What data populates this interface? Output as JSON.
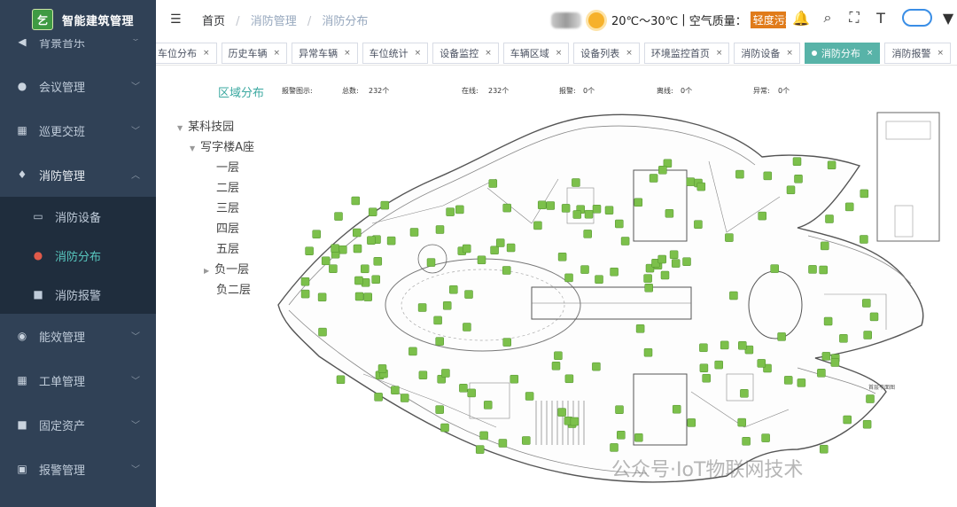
{
  "app": {
    "title": "智能建筑管理",
    "logo_glyph": "乞"
  },
  "sidebar": {
    "items": [
      {
        "label": "背景音乐",
        "icon": "speaker-icon"
      },
      {
        "label": "会议管理",
        "icon": "users-icon"
      },
      {
        "label": "巡更交班",
        "icon": "grid-icon"
      },
      {
        "label": "消防管理",
        "icon": "fire-icon"
      },
      {
        "label": "能效管理",
        "icon": "globe-icon"
      },
      {
        "label": "工单管理",
        "icon": "grid-icon"
      },
      {
        "label": "固定资产",
        "icon": "apps-icon"
      },
      {
        "label": "报警管理",
        "icon": "document-icon"
      }
    ],
    "submenu": [
      {
        "label": "消防设备",
        "icon": "briefcase-icon"
      },
      {
        "label": "消防分布",
        "icon": "location-pin-icon"
      },
      {
        "label": "消防报警",
        "icon": "apps-icon"
      }
    ]
  },
  "header": {
    "breadcrumb": [
      "首页",
      "消防管理",
      "消防分布"
    ],
    "weather": {
      "temp": "20℃～30℃",
      "sep": "|",
      "aq_label": "空气质量：",
      "aq_value": "轻度污染"
    },
    "colors": {
      "accent": "#58b3a8",
      "sidebar": "#304156",
      "aq": "#e07b1a"
    }
  },
  "tags": [
    {
      "label": "车位分布"
    },
    {
      "label": "历史车辆"
    },
    {
      "label": "异常车辆"
    },
    {
      "label": "车位统计"
    },
    {
      "label": "设备监控"
    },
    {
      "label": "车辆区域"
    },
    {
      "label": "设备列表"
    },
    {
      "label": "环境监控首页"
    },
    {
      "label": "消防设备"
    },
    {
      "label": "消防分布",
      "active": true
    },
    {
      "label": "消防报警"
    }
  ],
  "tree": {
    "title": "区域分布",
    "root": "某科技园",
    "building": "写字楼A座",
    "floors": [
      "一层",
      "二层",
      "三层",
      "四层",
      "五层",
      "负一层",
      "负二层"
    ]
  },
  "map": {
    "stats": {
      "legend": "报警图示:",
      "total_label": "总数:",
      "total": "232个",
      "online_label": "在线:",
      "online": "232个",
      "alarm_label": "报警:",
      "alarm": "0个",
      "offline_label": "离线:",
      "offline": "0个",
      "abnormal_label": "异常:",
      "abnormal": "0个"
    },
    "floor_label": "首层平面图",
    "watermark": "公众号·IoT物联网技术"
  }
}
